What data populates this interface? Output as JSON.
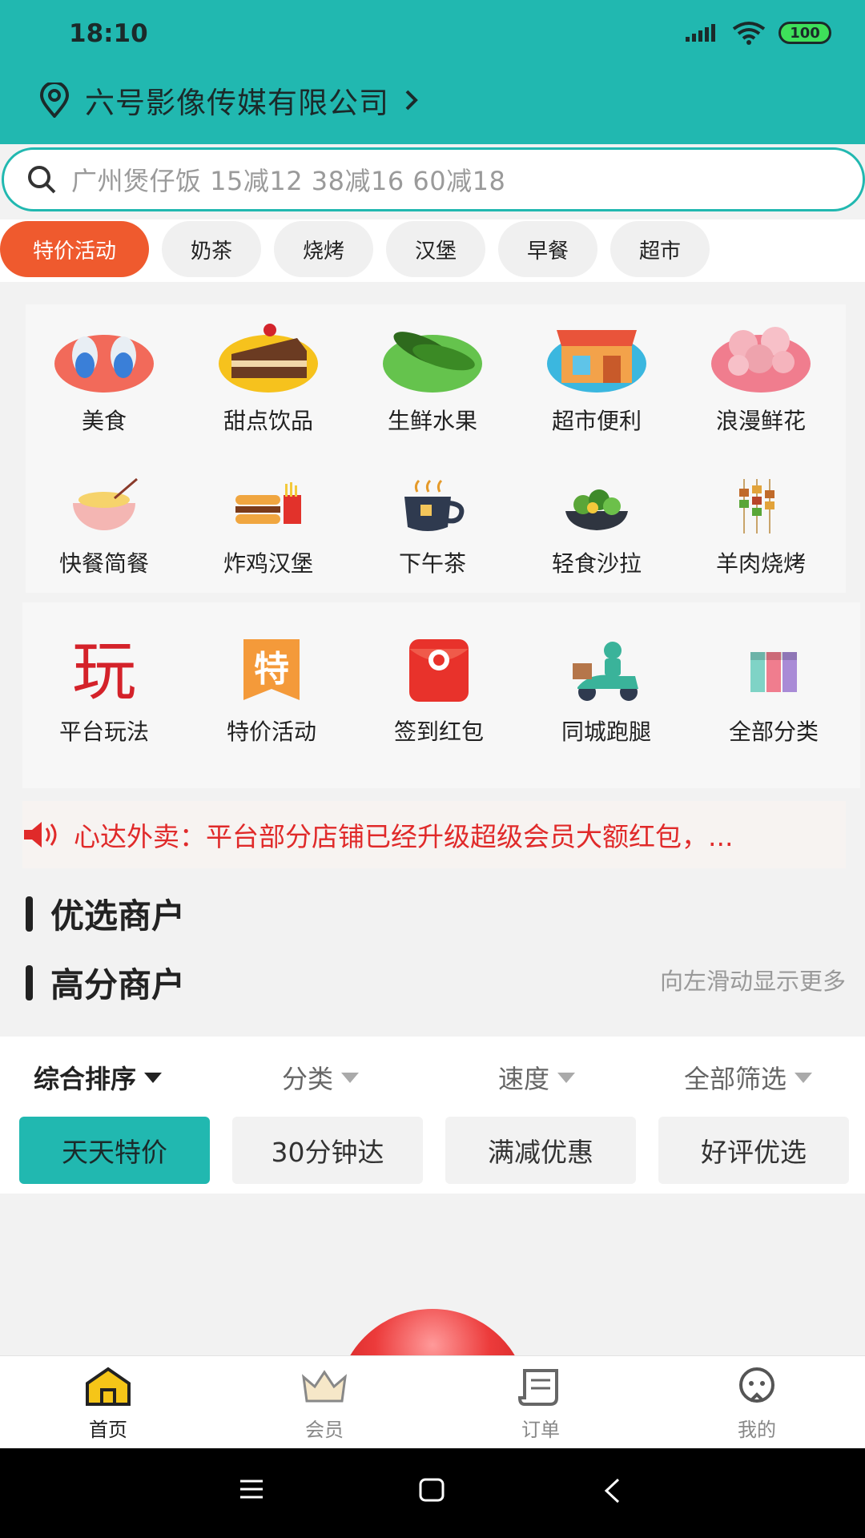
{
  "status": {
    "time": "18:10",
    "battery": "100"
  },
  "location": {
    "name": "六号影像传媒有限公司"
  },
  "search": {
    "placeholder": "广州煲仔饭 15减12 38减16 60减18"
  },
  "tags": [
    "特价活动",
    "奶茶",
    "烧烤",
    "汉堡",
    "早餐",
    "超市"
  ],
  "categories": [
    "美食",
    "甜点饮品",
    "生鲜水果",
    "超市便利",
    "浪漫鲜花",
    "快餐简餐",
    "炸鸡汉堡",
    "下午茶",
    "轻食沙拉",
    "羊肉烧烤"
  ],
  "features": [
    "平台玩法",
    "特价活动",
    "签到红包",
    "同城跑腿",
    "全部分类"
  ],
  "feature_icons": {
    "play": "玩",
    "special": "特"
  },
  "notice": {
    "text": "心达外卖：平台部分店铺已经升级超级会员大额红包，..."
  },
  "sections": {
    "preferred": "优选商户",
    "top_rated": "高分商户",
    "scroll_hint": "向左滑动显示更多"
  },
  "sort": [
    "综合排序",
    "分类",
    "速度",
    "全部筛选"
  ],
  "filters": [
    "天天特价",
    "30分钟达",
    "满减优惠",
    "好评优选"
  ],
  "tabbar": [
    "首页",
    "会员",
    "订单",
    "我的"
  ],
  "colors": {
    "brand": "#21b8b0",
    "accent": "#ef5a2e",
    "notice": "#e02a2a"
  }
}
